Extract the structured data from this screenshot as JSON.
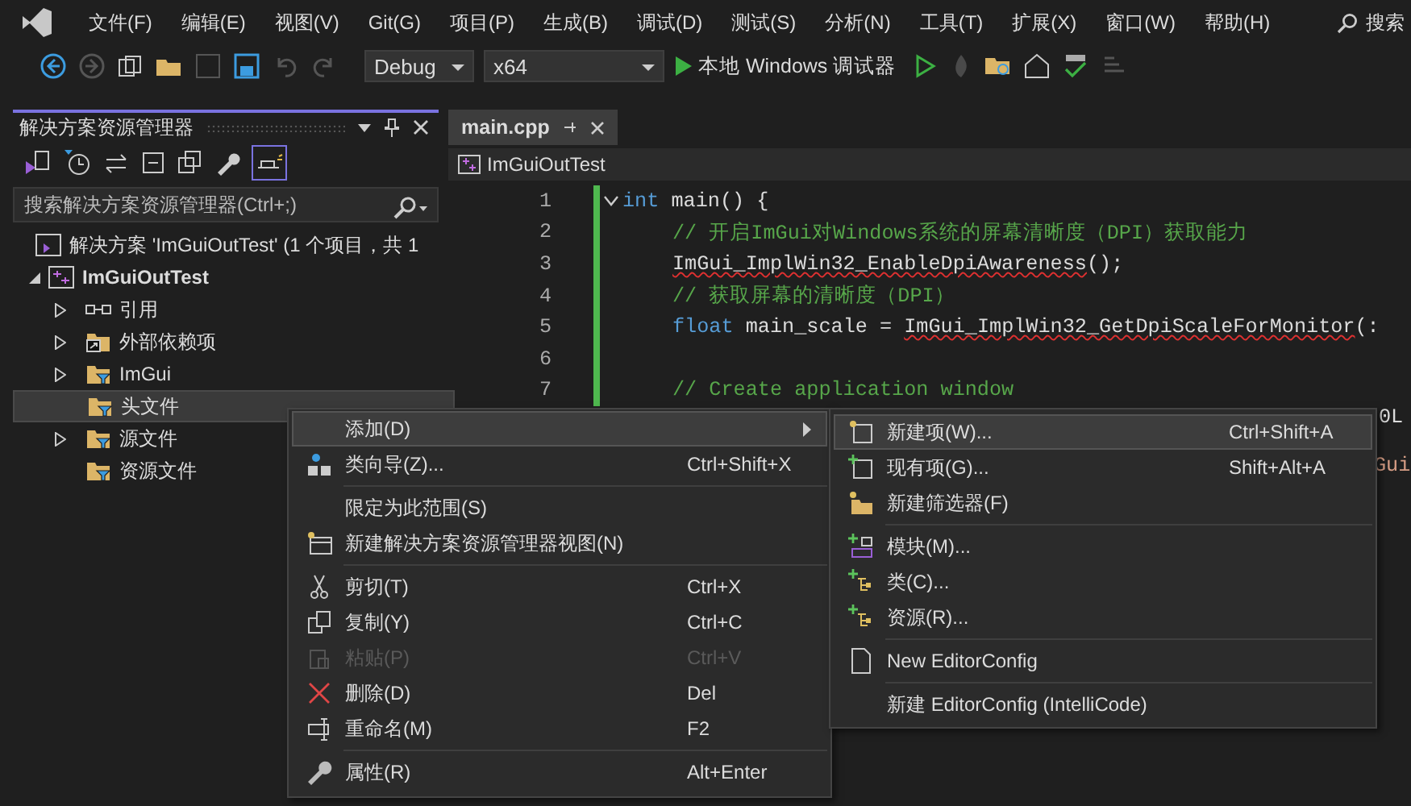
{
  "menubar": {
    "items": [
      "文件(F)",
      "编辑(E)",
      "视图(V)",
      "Git(G)",
      "项目(P)",
      "生成(B)",
      "调试(D)",
      "测试(S)",
      "分析(N)",
      "工具(T)",
      "扩展(X)",
      "窗口(W)",
      "帮助(H)"
    ],
    "search": "搜索"
  },
  "toolbar": {
    "configuration": "Debug",
    "platform": "x64",
    "run_label": "本地 Windows 调试器"
  },
  "solution_explorer": {
    "title": "解决方案资源管理器",
    "search": {
      "placeholder": "搜索解决方案资源管理器(Ctrl+;)"
    },
    "solution": {
      "label": "解决方案 'ImGuiOutTest' (1 个项目，共 1",
      "children": [
        {
          "label": "ImGuiOutTest",
          "expanded": true,
          "children": [
            {
              "label": "引用",
              "kind": "reference",
              "expanded": false,
              "selected": false
            },
            {
              "label": "外部依赖项",
              "kind": "external",
              "expanded": false,
              "selected": false
            },
            {
              "label": "ImGui",
              "kind": "filter",
              "expanded": false,
              "selected": false
            },
            {
              "label": "头文件",
              "kind": "filter",
              "selected": true
            },
            {
              "label": "源文件",
              "kind": "filter",
              "expanded": false,
              "selected": false
            },
            {
              "label": "资源文件",
              "kind": "filter",
              "selected": false
            }
          ]
        }
      ]
    }
  },
  "editor": {
    "tabs": [
      {
        "label": "main.cpp",
        "selected": true
      }
    ],
    "nav": "ImGuiOutTest",
    "lines": [
      {
        "number": "1",
        "segments": [
          {
            "kind": "keyword",
            "text": "int"
          },
          {
            "kind": "plain",
            "text": " main() {"
          }
        ],
        "children": [
          {
            "number": "2",
            "segments": [
              {
                "kind": "comment",
                "text": "// 开启ImGui对Windows系统的屏幕清晰度（DPI）获取能力"
              }
            ]
          },
          {
            "number": "3",
            "segments": [
              {
                "kind": "error",
                "text": "ImGui_ImplWin32_EnableDpiAwareness"
              },
              {
                "kind": "plain",
                "text": "();"
              }
            ]
          },
          {
            "number": "4",
            "segments": [
              {
                "kind": "comment",
                "text": "// 获取屏幕的清晰度（DPI）"
              }
            ]
          },
          {
            "number": "5",
            "segments": [
              {
                "kind": "keyword",
                "text": "float"
              },
              {
                "kind": "plain",
                "text": " main_scale = "
              },
              {
                "kind": "error",
                "text": "ImGui_ImplWin32_GetDpiScaleForMonitor"
              },
              {
                "kind": "plain",
                "text": "(:"
              }
            ]
          },
          {
            "number": "6"
          },
          {
            "number": "7",
            "segments": [
              {
                "kind": "comment",
                "text": "// Create application window"
              }
            ]
          }
        ]
      }
    ],
    "fragments": [
      {
        "kind": "plain",
        "text": "0L"
      },
      {
        "kind": "string",
        "text": "Gui"
      }
    ]
  },
  "context_menu": {
    "items": [
      {
        "kind": "submenu",
        "label": "添加(D)",
        "selected": true,
        "disabled": false
      },
      {
        "kind": "item",
        "label": "类向导(Z)...",
        "shortcut": "Ctrl+Shift+X",
        "selected": false,
        "disabled": false
      },
      {
        "kind": "separator"
      },
      {
        "kind": "item",
        "label": "限定为此范围(S)",
        "selected": false,
        "disabled": false
      },
      {
        "kind": "item",
        "label": "新建解决方案资源管理器视图(N)",
        "selected": false,
        "disabled": false
      },
      {
        "kind": "separator"
      },
      {
        "kind": "item",
        "label": "剪切(T)",
        "shortcut": "Ctrl+X",
        "selected": false,
        "disabled": false
      },
      {
        "kind": "item",
        "label": "复制(Y)",
        "shortcut": "Ctrl+C",
        "selected": false,
        "disabled": false
      },
      {
        "kind": "item",
        "label": "粘贴(P)",
        "shortcut": "Ctrl+V",
        "selected": false,
        "disabled": true
      },
      {
        "kind": "item",
        "label": "删除(D)",
        "shortcut": "Del",
        "selected": false,
        "disabled": false
      },
      {
        "kind": "item",
        "label": "重命名(M)",
        "shortcut": "F2",
        "selected": false,
        "disabled": false
      },
      {
        "kind": "separator"
      },
      {
        "kind": "item",
        "label": "属性(R)",
        "shortcut": "Alt+Enter",
        "selected": false,
        "disabled": false
      }
    ]
  },
  "submenu": {
    "items": [
      {
        "kind": "item",
        "label": "新建项(W)...",
        "shortcut": "Ctrl+Shift+A",
        "selected": true,
        "disabled": false
      },
      {
        "kind": "item",
        "label": "现有项(G)...",
        "shortcut": "Shift+Alt+A",
        "selected": false,
        "disabled": false
      },
      {
        "kind": "item",
        "label": "新建筛选器(F)",
        "selected": false,
        "disabled": false
      },
      {
        "kind": "separator"
      },
      {
        "kind": "item",
        "label": "模块(M)...",
        "selected": false,
        "disabled": false
      },
      {
        "kind": "item",
        "label": "类(C)...",
        "selected": false,
        "disabled": false
      },
      {
        "kind": "item",
        "label": "资源(R)...",
        "selected": false,
        "disabled": false
      },
      {
        "kind": "separator"
      },
      {
        "kind": "item",
        "label": "New EditorConfig",
        "selected": false,
        "disabled": false
      },
      {
        "kind": "separator"
      },
      {
        "kind": "item",
        "label": "新建 EditorConfig (IntelliCode)",
        "selected": false,
        "disabled": false
      }
    ]
  }
}
